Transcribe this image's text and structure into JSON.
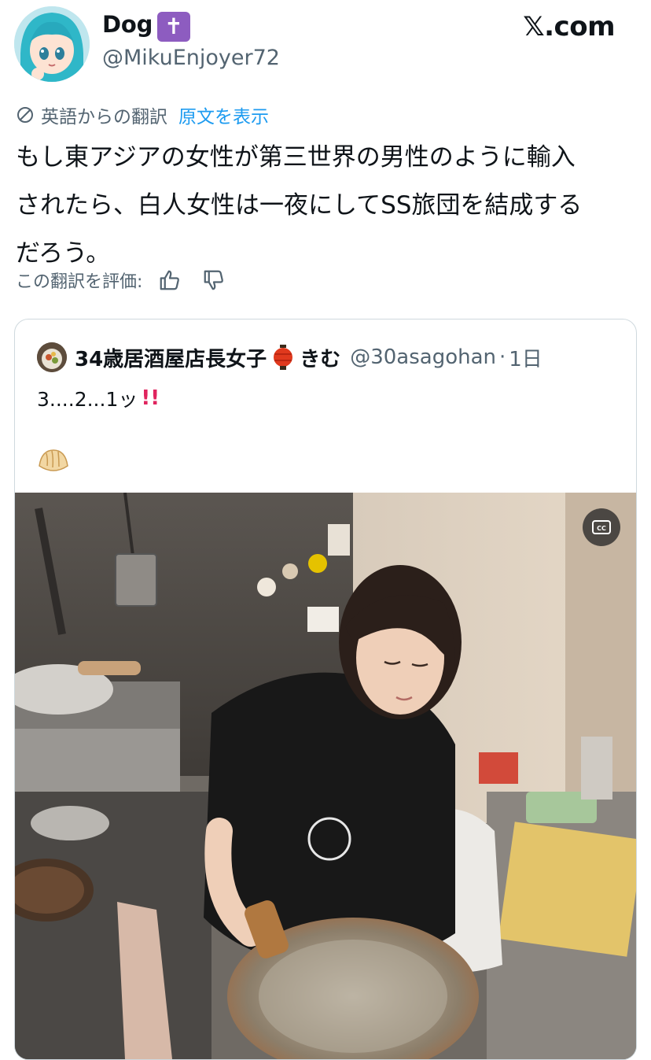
{
  "header": {
    "display_name": "Dog",
    "badge_emoji": "✝️",
    "badge_glyph": "✝",
    "handle": "@MikuEnjoyer72",
    "site_logo": "𝕏.com"
  },
  "translation": {
    "icon": "globe-icon",
    "label": "英語からの翻訳",
    "show_original": "原文を表示"
  },
  "tweet": {
    "text": "もし東アジアの女性が第三世界の男性のように輸入\nされたら、白人女性は一夜にしてSS旅団を結成する\nだろう。"
  },
  "rating": {
    "label": "この翻訳を評価:",
    "icons": [
      "thumbs-up-icon",
      "thumbs-down-icon"
    ]
  },
  "quote": {
    "author_name": "34歳居酒屋店長女子",
    "lantern_emoji": "🏮",
    "author_name_suffix": "きむ",
    "handle": "@30asagohan",
    "separator": "·",
    "time": "1日",
    "text": "3....2...1ッ",
    "bangs": "‼️",
    "emoji": "🥟",
    "media": {
      "type": "video",
      "cc_label": "CC"
    }
  },
  "colors": {
    "text_primary": "#0f1419",
    "text_secondary": "#536471",
    "link_blue": "#1d9bf0",
    "badge_purple": "#8d5cc0",
    "card_border": "#cfd9de"
  }
}
